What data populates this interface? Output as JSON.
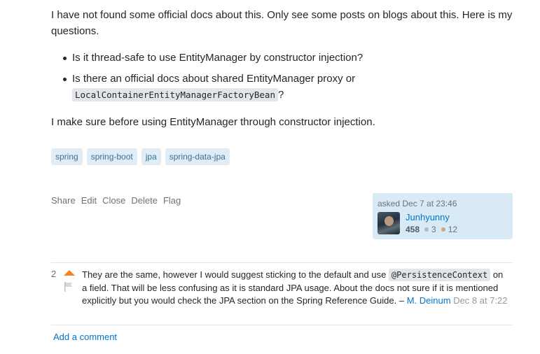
{
  "question": {
    "intro": "I have not found some official docs about this. Only see some posts on blogs about this. Here is my questions.",
    "bullets": {
      "b1": "Is it thread-safe to use EntityManager by constructor injection?",
      "b2_text": "Is there an official docs about shared EntityManager proxy or ",
      "b2_code": "LocalContainerEntityManagerFactoryBean",
      "b2_suffix": "?"
    },
    "closing": "I make sure before using EntityManager through constructor injection."
  },
  "tags": [
    "spring",
    "spring-boot",
    "jpa",
    "spring-data-jpa"
  ],
  "post_menu": [
    "Share",
    "Edit",
    "Close",
    "Delete",
    "Flag"
  ],
  "user_card": {
    "asked": "asked Dec 7 at 23:46",
    "username": "Junhyunny",
    "reputation": "458",
    "silver": "3",
    "bronze": "12"
  },
  "comment": {
    "score": "2",
    "text_1": "They are the same, however I would suggest sticking to the default and use ",
    "code": "@PersistenceContext",
    "text_2": " on a field. That will be less confusing as it is standard JPA usage. About the docs not sure if it is mentioned explicitly but you would check the JPA section on the Spring Reference Guide. – ",
    "user": "M. Deinum",
    "date": "Dec 8 at 7:22"
  },
  "add_comment": "Add a comment",
  "colors": {
    "tag_bg": "#e1ecf4",
    "tag_text": "#39739d",
    "link": "#0074cc",
    "user_card_bg": "#d9eaf7",
    "upvote": "#f48225"
  }
}
